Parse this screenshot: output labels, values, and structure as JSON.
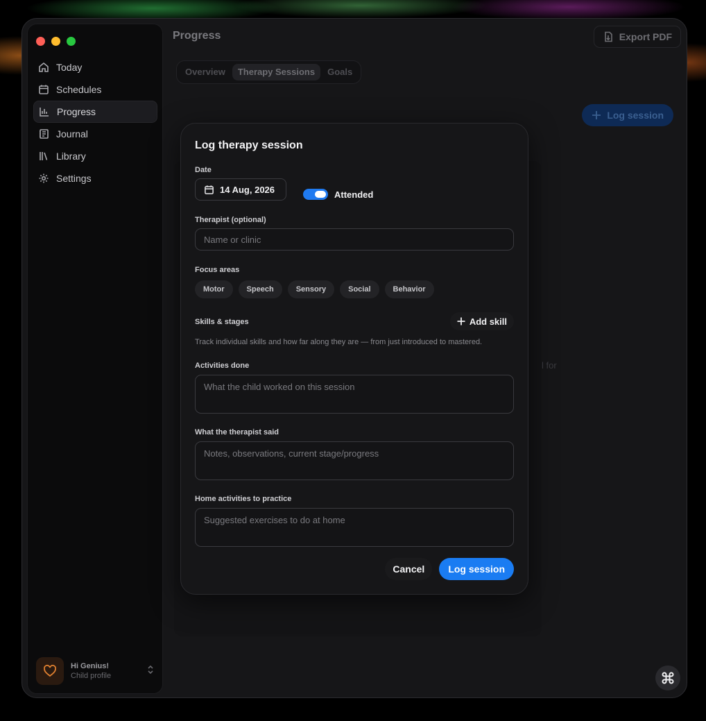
{
  "sidebar": {
    "items": [
      {
        "label": "Today",
        "icon": "home-icon",
        "active": false
      },
      {
        "label": "Schedules",
        "icon": "calendar-icon",
        "active": false
      },
      {
        "label": "Progress",
        "icon": "bar-chart-icon",
        "active": true
      },
      {
        "label": "Journal",
        "icon": "notebook-icon",
        "active": false
      },
      {
        "label": "Library",
        "icon": "books-icon",
        "active": false
      },
      {
        "label": "Settings",
        "icon": "gear-icon",
        "active": false
      }
    ],
    "profile": {
      "name": "Hi Genius!",
      "subtitle": "Child profile"
    }
  },
  "header": {
    "title": "Progress",
    "export_label": "Export PDF"
  },
  "tabs": [
    {
      "label": "Overview",
      "active": false
    },
    {
      "label": "Therapy Sessions",
      "active": true
    },
    {
      "label": "Goals",
      "active": false
    }
  ],
  "main": {
    "log_session_label": "Log session",
    "bg_hint_fragment": "l for"
  },
  "modal": {
    "title": "Log therapy session",
    "date_label": "Date",
    "date_value": "14 Aug, 2026",
    "attended_label": "Attended",
    "attended": true,
    "therapist_label": "Therapist (optional)",
    "therapist_placeholder": "Name or clinic",
    "focus_label": "Focus areas",
    "focus_areas": [
      "Motor",
      "Speech",
      "Sensory",
      "Social",
      "Behavior"
    ],
    "skills_label": "Skills & stages",
    "add_skill_label": "Add skill",
    "skills_hint": "Track individual skills and how far along they are — from just introduced to mastered.",
    "activities_label": "Activities done",
    "activities_placeholder": "What the child worked on this session",
    "therapist_said_label": "What the therapist said",
    "therapist_said_placeholder": "Notes, observations, current stage/progress",
    "home_label": "Home activities to practice",
    "home_placeholder": "Suggested exercises to do at home",
    "cancel_label": "Cancel",
    "submit_label": "Log session"
  },
  "colors": {
    "accent": "#1a7cf2",
    "background": "#161618"
  }
}
